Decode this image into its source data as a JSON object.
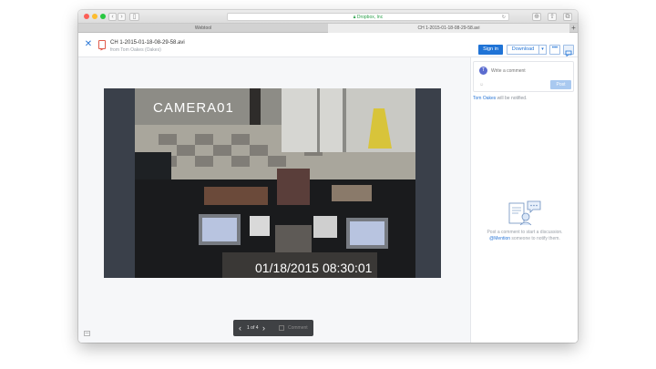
{
  "browser": {
    "url": "Dropbox, Inc",
    "tabs": [
      "Webtool",
      "CH 1-2015-01-18-08-29-58.avi"
    ]
  },
  "file": {
    "name": "CH 1-2015-01-18-08-29-58.avi",
    "owner": "from Tom Oakes (Oakes)"
  },
  "header": {
    "signin_label": "Sign in",
    "download_label": "Download",
    "more_label": "•••"
  },
  "video": {
    "camera_label": "CAMERA01",
    "timestamp": "01/18/2015 08:30:01"
  },
  "pager": {
    "page_text": "1 of 4",
    "comment_label": "Comment"
  },
  "comments": {
    "avatar_initial": "T",
    "input_placeholder": "Write a comment",
    "post_label": "Post",
    "notify_name": "Tom Oakes",
    "notify_rest": " will be notified.",
    "empty_line1": "Post a comment to start a discussion.",
    "empty_mention": "@Mention",
    "empty_line2_rest": " someone to notify them."
  },
  "colors": {
    "accent": "#1f73d6",
    "video_bg": "#111111"
  }
}
